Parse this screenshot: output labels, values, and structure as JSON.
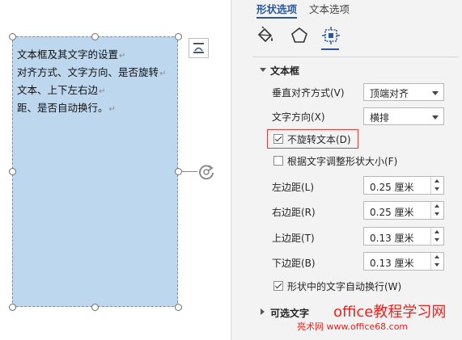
{
  "document": {
    "textbox_lines": [
      "文本框及其文字的设置",
      "对齐方式、文字方向、是否旋转",
      "文本、上下左右边",
      "距、是否自动换行。"
    ],
    "paragraph_mark": "↵",
    "fill_color": "#bdd7ee"
  },
  "pane": {
    "tabs": [
      "形状选项",
      "文本选项"
    ],
    "active_tab": "形状选项",
    "category_icons": [
      "fill-bucket-icon",
      "pentagon-icon",
      "layout-properties-icon"
    ],
    "section_title": "文本框",
    "vertical_align": {
      "label": "垂直对齐方式(V)",
      "value": "顶端对齐"
    },
    "text_direction": {
      "label": "文字方向(X)",
      "value": "横排"
    },
    "no_rotate": {
      "label": "不旋转文本(D)",
      "checked": true
    },
    "resize_shape": {
      "label": "根据文字调整形状大小(F)",
      "checked": false
    },
    "margins": [
      {
        "label": "左边距(L)",
        "value": "0.25 厘米"
      },
      {
        "label": "右边距(R)",
        "value": "0.25 厘米"
      },
      {
        "label": "上边距(T)",
        "value": "0.13 厘米"
      },
      {
        "label": "下边距(B)",
        "value": "0.13 厘米"
      }
    ],
    "wrap_text": {
      "label": "形状中的文字自动换行(W)",
      "checked": true
    },
    "alt_text_title": "可选文字"
  },
  "watermark": {
    "line1": "office教程学习网",
    "line2": "亮术网 www.office68.com"
  },
  "colors": {
    "accent": "#2b579a",
    "highlight": "#e0403a",
    "watermark": "#e8231f"
  }
}
